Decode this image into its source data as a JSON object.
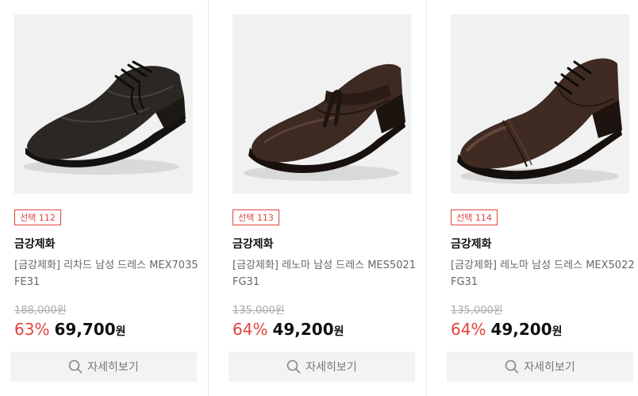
{
  "products": [
    {
      "badge": "선택 112",
      "brand": "금강제화",
      "name": "[금강제화] 리차드 남성 드레스 MEX7035FE31",
      "original_price": "188,000원",
      "discount": "63%",
      "price": "69,700",
      "currency": "원",
      "detail_label": "자세히보기",
      "image_icon": "derby-shoe-black",
      "shoe_color": "#2b2723"
    },
    {
      "badge": "선택 113",
      "brand": "금강제화",
      "name": "[금강제화] 레노마 남성 드레스 MES5021FG31",
      "original_price": "135,000원",
      "discount": "64%",
      "price": "49,200",
      "currency": "원",
      "detail_label": "자세히보기",
      "image_icon": "tassel-loafer-brown",
      "shoe_color": "#3d2a22"
    },
    {
      "badge": "선택 114",
      "brand": "금강제화",
      "name": "[금강제화] 레노마 남성 드레스 MEX5022FG31",
      "original_price": "135,000원",
      "discount": "64%",
      "price": "49,200",
      "currency": "원",
      "detail_label": "자세히보기",
      "image_icon": "oxford-captoe-brown",
      "shoe_color": "#3f2b22"
    }
  ],
  "colors": {
    "accent_red": "#e0433f",
    "button_bg": "#f3f3f3",
    "image_bg": "#f1f1f1"
  }
}
